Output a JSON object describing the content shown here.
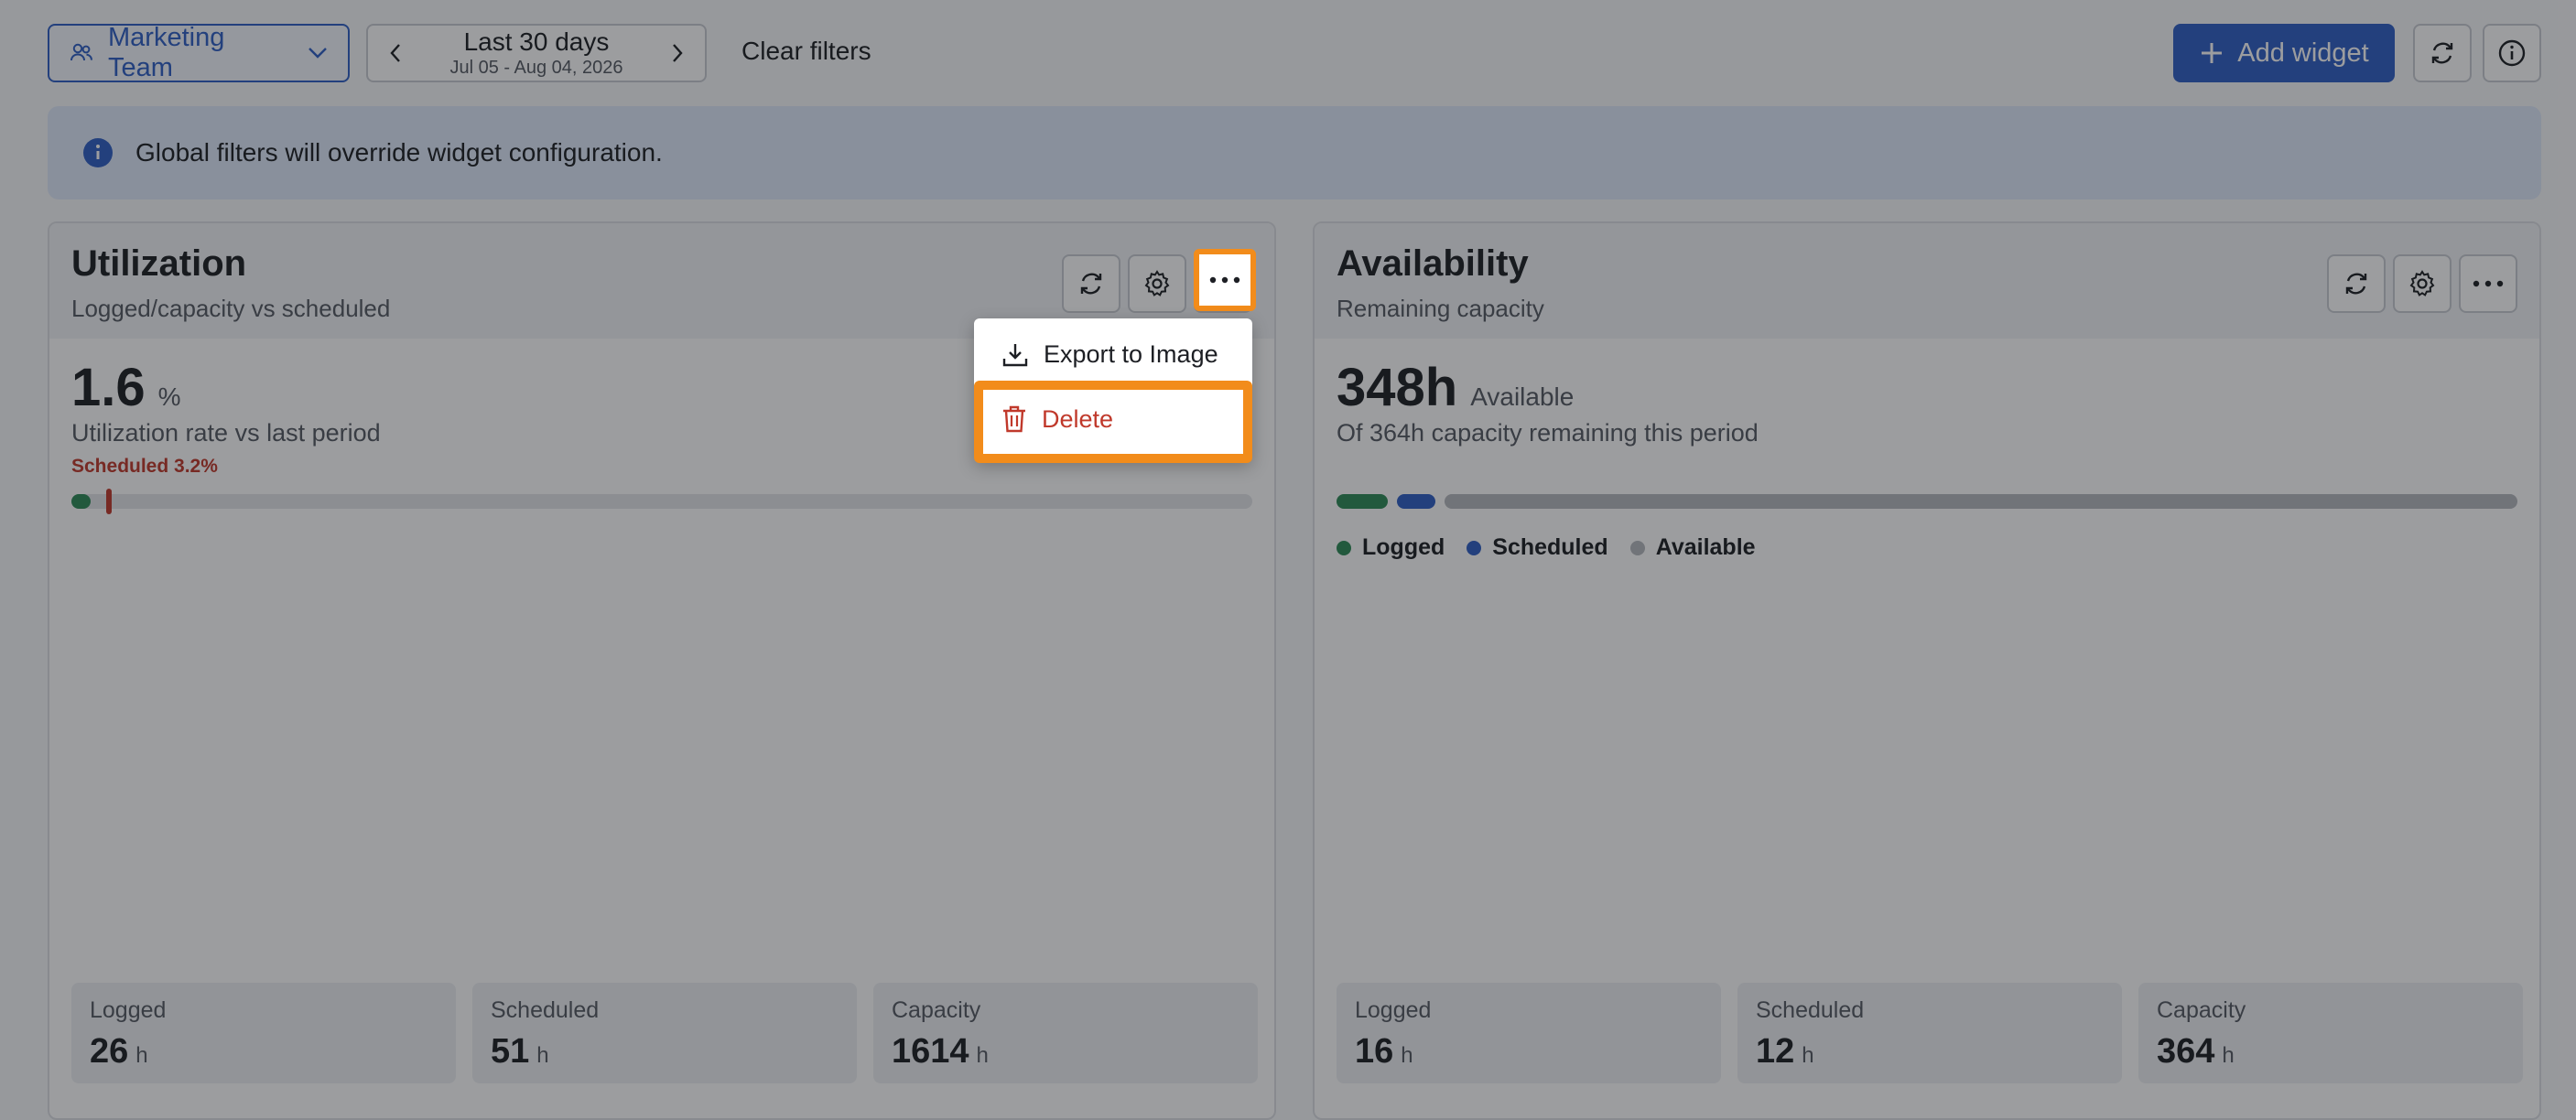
{
  "toolbar": {
    "team_label": "Marketing Team",
    "date_range_label": "Last 30 days",
    "date_range_sub": "Jul 05 - Aug 04, 2026",
    "clear_filters": "Clear filters",
    "add_widget": "Add widget"
  },
  "banner": {
    "text": "Global filters will override widget configuration."
  },
  "utilization": {
    "title": "Utilization",
    "subtitle": "Logged/capacity vs scheduled",
    "value": "1.6",
    "unit": "%",
    "description": "Utilization rate vs last period",
    "scheduled_label": "Scheduled 3.2%",
    "logged_pct": 1.6,
    "scheduled_pct": 3.2,
    "stats": [
      {
        "label": "Logged",
        "value": "26",
        "unit": "h"
      },
      {
        "label": "Scheduled",
        "value": "51",
        "unit": "h"
      },
      {
        "label": "Capacity",
        "value": "1614",
        "unit": "h"
      }
    ]
  },
  "availability": {
    "title": "Availability",
    "subtitle": "Remaining capacity",
    "value": "348h",
    "unit": "Available",
    "description": "Of 364h capacity remaining this period",
    "legend": [
      "Logged",
      "Scheduled",
      "Available"
    ],
    "stats": [
      {
        "label": "Logged",
        "value": "16",
        "unit": "h"
      },
      {
        "label": "Scheduled",
        "value": "12",
        "unit": "h"
      },
      {
        "label": "Capacity",
        "value": "364",
        "unit": "h"
      }
    ]
  },
  "menu": {
    "export": "Export to Image",
    "delete": "Delete"
  },
  "colors": {
    "primary": "#2f5fc4",
    "logged": "#2e8b57",
    "scheduled": "#2f5fc4",
    "available": "#b5b8be",
    "danger": "#c0392b",
    "highlight": "#f28c1b"
  }
}
